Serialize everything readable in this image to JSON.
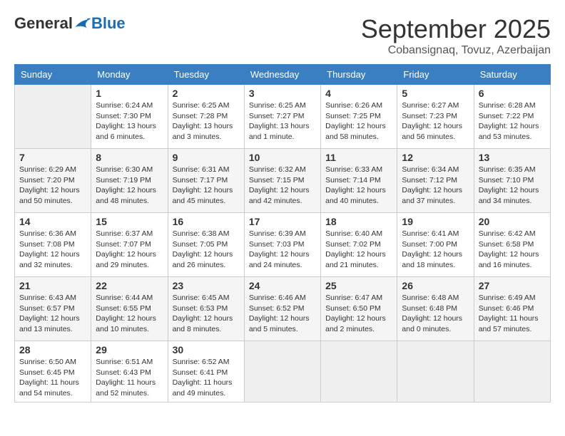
{
  "logo": {
    "general": "General",
    "blue": "Blue"
  },
  "title": "September 2025",
  "subtitle": "Cobansignaq, Tovuz, Azerbaijan",
  "days_of_week": [
    "Sunday",
    "Monday",
    "Tuesday",
    "Wednesday",
    "Thursday",
    "Friday",
    "Saturday"
  ],
  "weeks": [
    [
      {
        "day": null
      },
      {
        "day": "1",
        "sunrise": "6:24 AM",
        "sunset": "7:30 PM",
        "daylight": "13 hours and 6 minutes."
      },
      {
        "day": "2",
        "sunrise": "6:25 AM",
        "sunset": "7:28 PM",
        "daylight": "13 hours and 3 minutes."
      },
      {
        "day": "3",
        "sunrise": "6:25 AM",
        "sunset": "7:27 PM",
        "daylight": "13 hours and 1 minute."
      },
      {
        "day": "4",
        "sunrise": "6:26 AM",
        "sunset": "7:25 PM",
        "daylight": "12 hours and 58 minutes."
      },
      {
        "day": "5",
        "sunrise": "6:27 AM",
        "sunset": "7:23 PM",
        "daylight": "12 hours and 56 minutes."
      },
      {
        "day": "6",
        "sunrise": "6:28 AM",
        "sunset": "7:22 PM",
        "daylight": "12 hours and 53 minutes."
      }
    ],
    [
      {
        "day": "7",
        "sunrise": "6:29 AM",
        "sunset": "7:20 PM",
        "daylight": "12 hours and 50 minutes."
      },
      {
        "day": "8",
        "sunrise": "6:30 AM",
        "sunset": "7:19 PM",
        "daylight": "12 hours and 48 minutes."
      },
      {
        "day": "9",
        "sunrise": "6:31 AM",
        "sunset": "7:17 PM",
        "daylight": "12 hours and 45 minutes."
      },
      {
        "day": "10",
        "sunrise": "6:32 AM",
        "sunset": "7:15 PM",
        "daylight": "12 hours and 42 minutes."
      },
      {
        "day": "11",
        "sunrise": "6:33 AM",
        "sunset": "7:14 PM",
        "daylight": "12 hours and 40 minutes."
      },
      {
        "day": "12",
        "sunrise": "6:34 AM",
        "sunset": "7:12 PM",
        "daylight": "12 hours and 37 minutes."
      },
      {
        "day": "13",
        "sunrise": "6:35 AM",
        "sunset": "7:10 PM",
        "daylight": "12 hours and 34 minutes."
      }
    ],
    [
      {
        "day": "14",
        "sunrise": "6:36 AM",
        "sunset": "7:08 PM",
        "daylight": "12 hours and 32 minutes."
      },
      {
        "day": "15",
        "sunrise": "6:37 AM",
        "sunset": "7:07 PM",
        "daylight": "12 hours and 29 minutes."
      },
      {
        "day": "16",
        "sunrise": "6:38 AM",
        "sunset": "7:05 PM",
        "daylight": "12 hours and 26 minutes."
      },
      {
        "day": "17",
        "sunrise": "6:39 AM",
        "sunset": "7:03 PM",
        "daylight": "12 hours and 24 minutes."
      },
      {
        "day": "18",
        "sunrise": "6:40 AM",
        "sunset": "7:02 PM",
        "daylight": "12 hours and 21 minutes."
      },
      {
        "day": "19",
        "sunrise": "6:41 AM",
        "sunset": "7:00 PM",
        "daylight": "12 hours and 18 minutes."
      },
      {
        "day": "20",
        "sunrise": "6:42 AM",
        "sunset": "6:58 PM",
        "daylight": "12 hours and 16 minutes."
      }
    ],
    [
      {
        "day": "21",
        "sunrise": "6:43 AM",
        "sunset": "6:57 PM",
        "daylight": "12 hours and 13 minutes."
      },
      {
        "day": "22",
        "sunrise": "6:44 AM",
        "sunset": "6:55 PM",
        "daylight": "12 hours and 10 minutes."
      },
      {
        "day": "23",
        "sunrise": "6:45 AM",
        "sunset": "6:53 PM",
        "daylight": "12 hours and 8 minutes."
      },
      {
        "day": "24",
        "sunrise": "6:46 AM",
        "sunset": "6:52 PM",
        "daylight": "12 hours and 5 minutes."
      },
      {
        "day": "25",
        "sunrise": "6:47 AM",
        "sunset": "6:50 PM",
        "daylight": "12 hours and 2 minutes."
      },
      {
        "day": "26",
        "sunrise": "6:48 AM",
        "sunset": "6:48 PM",
        "daylight": "12 hours and 0 minutes."
      },
      {
        "day": "27",
        "sunrise": "6:49 AM",
        "sunset": "6:46 PM",
        "daylight": "11 hours and 57 minutes."
      }
    ],
    [
      {
        "day": "28",
        "sunrise": "6:50 AM",
        "sunset": "6:45 PM",
        "daylight": "11 hours and 54 minutes."
      },
      {
        "day": "29",
        "sunrise": "6:51 AM",
        "sunset": "6:43 PM",
        "daylight": "11 hours and 52 minutes."
      },
      {
        "day": "30",
        "sunrise": "6:52 AM",
        "sunset": "6:41 PM",
        "daylight": "11 hours and 49 minutes."
      },
      {
        "day": null
      },
      {
        "day": null
      },
      {
        "day": null
      },
      {
        "day": null
      }
    ]
  ]
}
